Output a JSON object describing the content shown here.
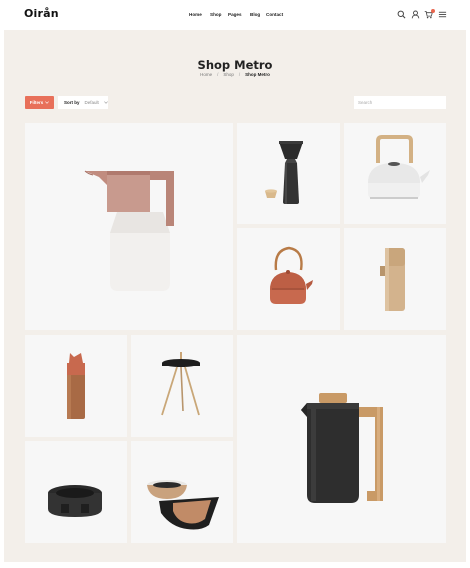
{
  "header": {
    "logo": "Oirån",
    "nav": [
      "Home",
      "Shop",
      "Pages",
      "Blog",
      "Contact"
    ],
    "icons": [
      "search-icon",
      "user-icon",
      "cart-icon",
      "menu-icon"
    ],
    "accent": "#e8654d"
  },
  "page": {
    "title": "Shop Metro",
    "breadcrumb": [
      "Home",
      "Shop",
      "Shop Metro"
    ]
  },
  "toolbar": {
    "filters_label": "Filters",
    "sort_label": "Sort by",
    "sort_value": "Default",
    "search_placeholder": "Search"
  },
  "colors": {
    "background": "#f3efea",
    "tile": "#f7f7f7",
    "filters_button": "#e8705a"
  },
  "products": [
    "white-jug-with-rose-handle",
    "black-pour-over-coffee-maker",
    "white-kettle-with-wood-handle",
    "terracotta-teapot",
    "wooden-pepper-mill",
    "terracotta-bottle",
    "black-side-table",
    "black-french-press",
    "black-tealight-warmer",
    "stacked-bowls"
  ]
}
